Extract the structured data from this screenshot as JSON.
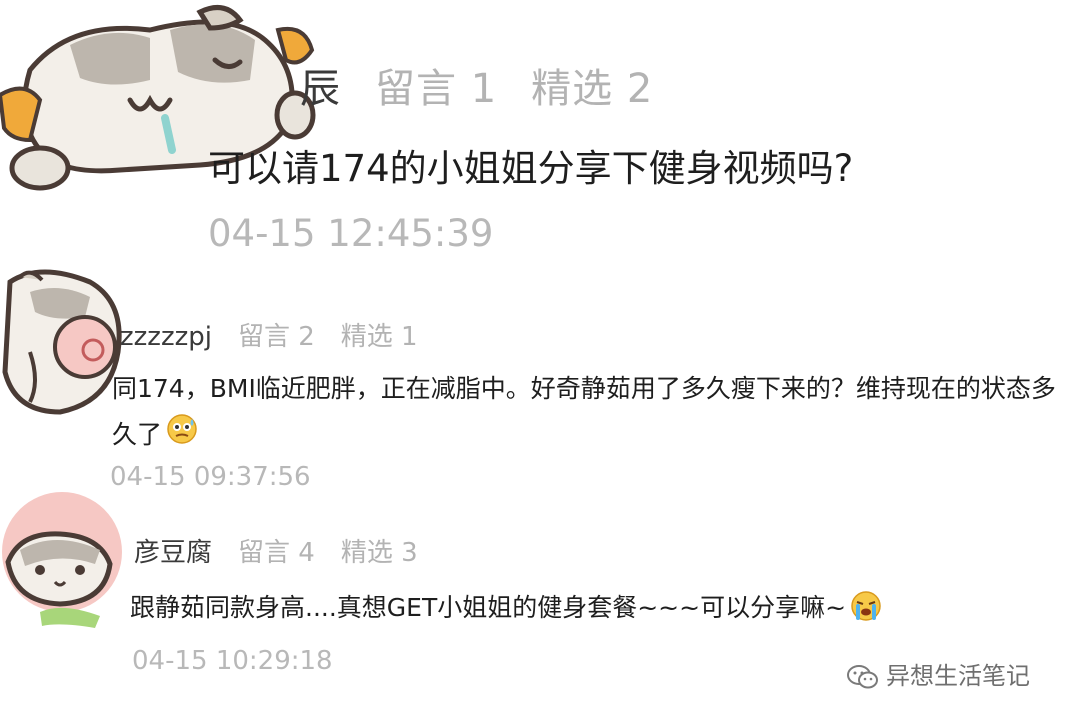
{
  "comments": [
    {
      "name": "辰",
      "likes_label": "留言 1",
      "featured_label": "精选 2",
      "text": "可以请174的小姐姐分享下健身视频吗?",
      "time": "04-15 12:45:39"
    },
    {
      "name": "zzzzzpj",
      "likes_label": "留言 2",
      "featured_label": "精选 1",
      "text": "同174，BMI临近肥胖，正在减脂中。好奇静茹用了多久瘦下来的？维持现在的状态多久了",
      "emoji": "nervous-sweat-emoji",
      "time": "04-15 09:37:56"
    },
    {
      "name": "彦豆腐",
      "likes_label": "留言 4",
      "featured_label": "精选 3",
      "text": "跟静茹同款身高....真想GET小姐姐的健身套餐~~~可以分享嘛~",
      "emoji": "crying-emoji",
      "time": "04-15 10:29:18"
    }
  ],
  "watermark": {
    "text": "异想生活笔记",
    "icon": "wechat-icon"
  },
  "colors": {
    "meta_gray": "#b3b3b3",
    "text_dark": "#1e1e1e",
    "avatar_pink": "#f6c8c4",
    "cat_gray": "#b9b3ab",
    "cat_orange": "#f0a93a"
  }
}
